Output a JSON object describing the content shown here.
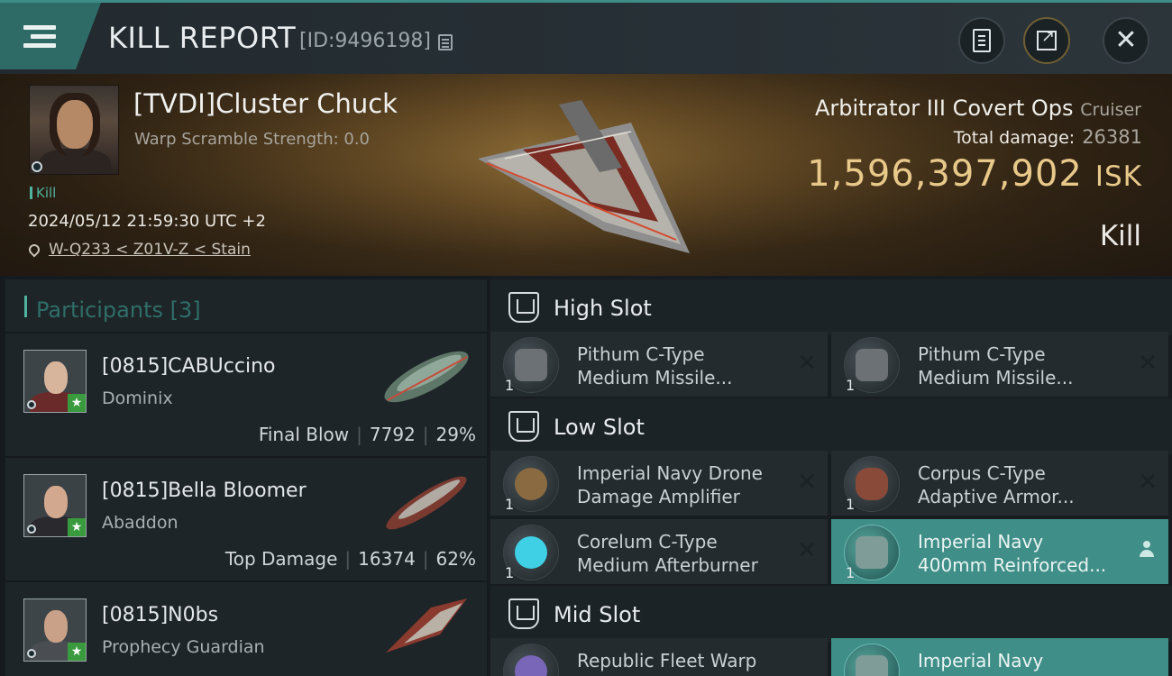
{
  "header": {
    "title": "KILL REPORT",
    "report_id": "[ID:9496198]",
    "buttons": [
      "clipboard-icon",
      "share-icon",
      "close-icon"
    ]
  },
  "victim": {
    "name": "[TVDI]Cluster Chuck",
    "warp_scramble": "Warp Scramble Strength: 0.0",
    "tag": "Kill",
    "timestamp": "2024/05/12 21:59:30 UTC +2",
    "location": "W-Q233 < Z01V-Z < Stain"
  },
  "ship": {
    "name": "Arbitrator III Covert Ops",
    "class": "Cruiser",
    "total_damage_label": "Total damage:",
    "total_damage": "26381",
    "isk_value": "1,596,397,902",
    "isk_unit": "ISK",
    "result": "Kill"
  },
  "participants": {
    "header": "Participants",
    "count": "[3]",
    "rows": [
      {
        "name": "[0815]CABUccino",
        "ship": "Dominix",
        "role": "Final Blow",
        "damage": "7792",
        "percent": "29%"
      },
      {
        "name": "[0815]Bella Bloomer",
        "ship": "Abaddon",
        "role": "Top Damage",
        "damage": "16374",
        "percent": "62%"
      },
      {
        "name": "[0815]N0bs",
        "ship": "Prophecy Guardian"
      }
    ]
  },
  "fitting": {
    "slots": [
      {
        "title": "High Slot"
      },
      {
        "title": "Low Slot"
      },
      {
        "title": "Mid Slot"
      }
    ],
    "modules": [
      {
        "qty": "1",
        "line1": "Pithum C-Type",
        "line2": "Medium Missile..."
      },
      {
        "qty": "1",
        "line1": "Pithum C-Type",
        "line2": "Medium Missile..."
      },
      {
        "qty": "1",
        "line1": "Imperial Navy Drone",
        "line2": "Damage Amplifier"
      },
      {
        "qty": "1",
        "line1": "Corpus C-Type",
        "line2": "Adaptive Armor..."
      },
      {
        "qty": "1",
        "line1": "Corelum C-Type",
        "line2": "Medium Afterburner"
      },
      {
        "qty": "1",
        "line1": "Imperial Navy",
        "line2": "400mm Reinforced..."
      },
      {
        "qty": "",
        "line1": "Republic Fleet Warp",
        "line2": ""
      },
      {
        "qty": "",
        "line1": "Imperial Navy",
        "line2": ""
      }
    ]
  },
  "colors": {
    "accent": "#3f8e87",
    "isk": "#e8c98a",
    "kill": "#4fb39f"
  }
}
